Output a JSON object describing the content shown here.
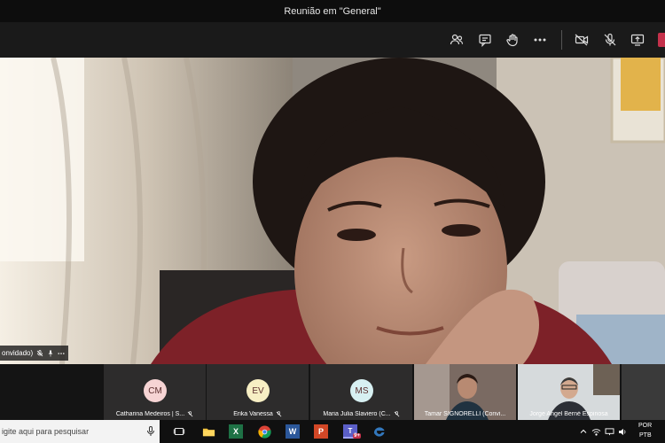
{
  "window": {
    "title": "Reunião em \"General\""
  },
  "toolbar": {
    "icons": [
      "participants-icon",
      "chat-icon",
      "raise-hand-icon",
      "more-options-icon",
      "camera-off-icon",
      "mic-off-icon",
      "share-screen-icon"
    ],
    "end_call_color": "#c4314b"
  },
  "main_video": {
    "name_tag": "onvidado)"
  },
  "participants": [
    {
      "initials": "CM",
      "name": "Catharina Medeiros | S...",
      "avatar_color": "#f6d4d4"
    },
    {
      "initials": "EV",
      "name": "Erika Vanessa",
      "avatar_color": "#f7efc4"
    },
    {
      "initials": "MS",
      "name": "Maria Julia Slaviero (C...",
      "avatar_color": "#d7f0f2"
    },
    {
      "initials": "",
      "name": "Tamar SIGNORELLI (Convi...",
      "avatar_color": ""
    },
    {
      "initials": "",
      "name": "Jorge Angel Berné Espinosa",
      "avatar_color": ""
    }
  ],
  "taskbar": {
    "search_placeholder": "igite aqui para pesquisar",
    "teams_badge": "9+",
    "language": "POR",
    "keyboard": "PTB"
  }
}
